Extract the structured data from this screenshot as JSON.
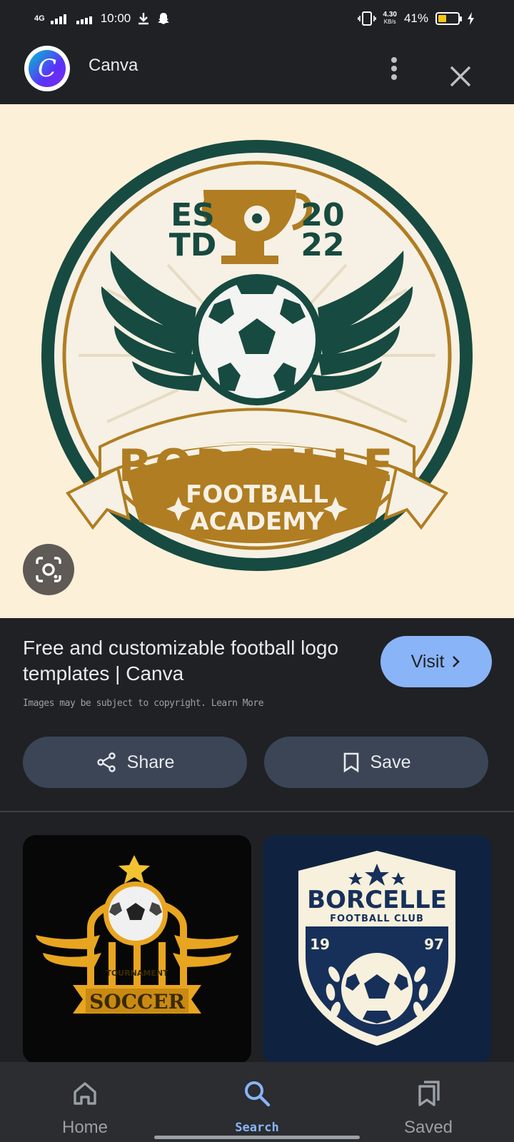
{
  "status_bar": {
    "network": "4G",
    "time": "10:00",
    "speed": "4.30",
    "speed_unit": "KB/s",
    "battery": "41%",
    "battery_level": 0.41
  },
  "header": {
    "app_name": "Canva",
    "app_icon_letter": "C"
  },
  "hero_image": {
    "estd_left": "ES",
    "estd_left2": "TD",
    "year_top": "20",
    "year_bottom": "22",
    "brand": "BORCELLE",
    "line1": "FOOTBALL",
    "line2": "ACADEMY",
    "colors": {
      "background": "#fdf0d9",
      "green": "#174a40",
      "gold": "#b07d22",
      "cream": "#f6f1e4"
    }
  },
  "result": {
    "title": "Free and customizable football logo templates | Canva",
    "visit_label": "Visit",
    "copyright": "Images may be subject to copyright. Learn More"
  },
  "actions": {
    "share_label": "Share",
    "save_label": "Save"
  },
  "related": [
    {
      "small_text": "TOURNAMENT",
      "big_text": "SOCCER"
    },
    {
      "brand": "BORCELLE",
      "sub": "FOOTBALL CLUB",
      "year_left": "19",
      "year_right": "97"
    }
  ],
  "bottom_nav": {
    "items": [
      {
        "label": "Home",
        "icon": "home-icon"
      },
      {
        "label": "Search",
        "icon": "search-icon",
        "active": true
      },
      {
        "label": "Saved",
        "icon": "saved-icon"
      }
    ],
    "active_color": "#8ab4f8"
  }
}
